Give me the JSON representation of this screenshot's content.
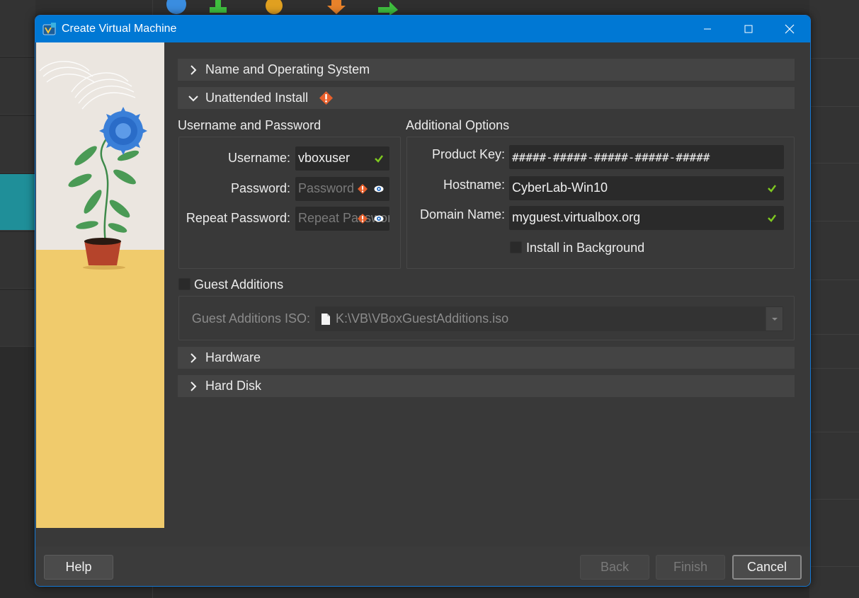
{
  "window": {
    "title": "Create Virtual Machine",
    "accent_color": "#0078d4"
  },
  "sections": {
    "name_os": {
      "label": "Name and Operating System",
      "expanded": false
    },
    "unattended": {
      "label": "Unattended Install",
      "expanded": true,
      "warning_icon": "warning-icon"
    },
    "hardware": {
      "label": "Hardware",
      "expanded": false
    },
    "hard_disk": {
      "label": "Hard Disk",
      "expanded": false
    }
  },
  "credentials": {
    "title": "Username and Password",
    "username_label": "Username:",
    "username_value": "vboxuser",
    "password_label": "Password:",
    "password_placeholder": "Password",
    "repeat_label": "Repeat Password:",
    "repeat_placeholder": "Repeat Password"
  },
  "options": {
    "title": "Additional Options",
    "product_key_label": "Product Key:",
    "product_key_value": "#####-#####-#####-#####-#####",
    "hostname_label": "Hostname:",
    "hostname_value": "CyberLab-Win10",
    "domain_label": "Domain Name:",
    "domain_value": "myguest.virtualbox.org",
    "install_bg_label": "Install in Background",
    "install_bg_checked": false
  },
  "guest_additions": {
    "label": "Guest Additions",
    "checked": false,
    "iso_label": "Guest Additions ISO:",
    "iso_value": "K:\\VB\\VBoxGuestAdditions.iso"
  },
  "buttons": {
    "help": "Help",
    "back": "Back",
    "finish": "Finish",
    "cancel": "Cancel"
  }
}
